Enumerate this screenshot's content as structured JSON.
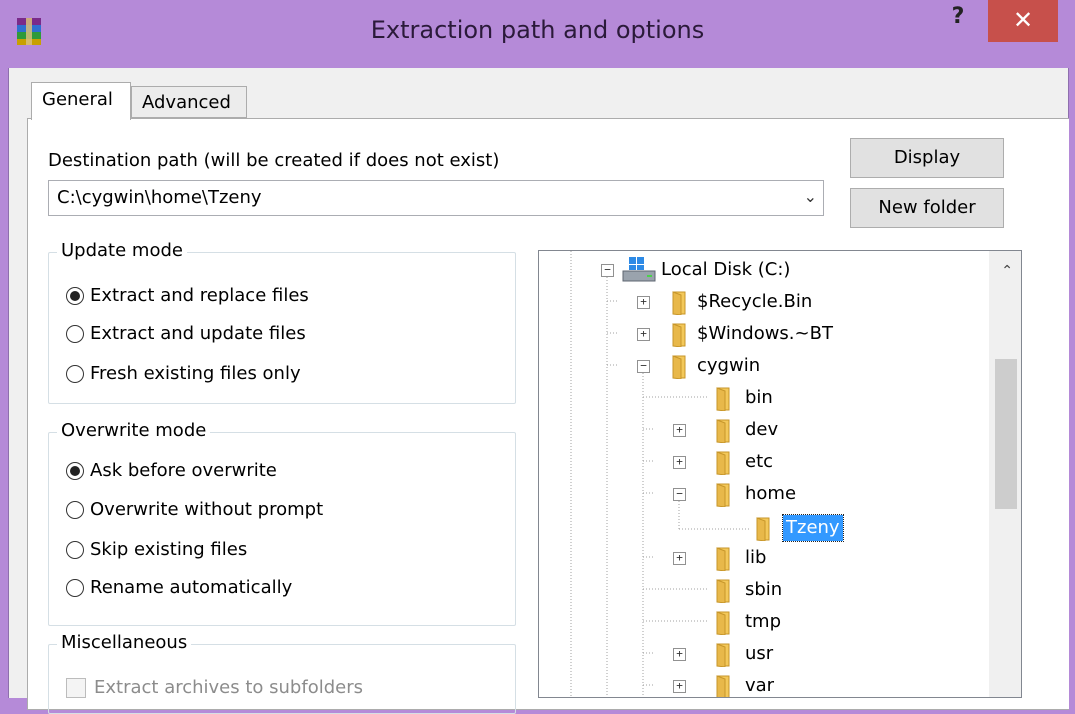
{
  "window": {
    "title": "Extraction path and options",
    "help_label": "?",
    "close_label": "✕"
  },
  "tabs": [
    {
      "label": "General",
      "active": true
    },
    {
      "label": "Advanced",
      "active": false
    }
  ],
  "destination": {
    "label": "Destination path (will be created if does not exist)",
    "value": "C:\\cygwin\\home\\Tzeny"
  },
  "buttons": {
    "display": "Display",
    "new_folder": "New folder"
  },
  "update_mode": {
    "title": "Update mode",
    "options": [
      {
        "label": "Extract and replace files",
        "selected": true
      },
      {
        "label": "Extract and update files",
        "selected": false
      },
      {
        "label": "Fresh existing files only",
        "selected": false
      }
    ]
  },
  "overwrite_mode": {
    "title": "Overwrite mode",
    "options": [
      {
        "label": "Ask before overwrite",
        "selected": true
      },
      {
        "label": "Overwrite without prompt",
        "selected": false
      },
      {
        "label": "Skip existing files",
        "selected": false
      },
      {
        "label": "Rename automatically",
        "selected": false
      }
    ]
  },
  "misc": {
    "title": "Miscellaneous",
    "options": [
      {
        "label": "Extract archives to subfolders",
        "checked": false,
        "enabled": false
      }
    ]
  },
  "tree": {
    "items": [
      {
        "label": "Local Disk (C:)",
        "icon": "drive-icon",
        "expander": "minus"
      },
      {
        "label": "$Recycle.Bin",
        "icon": "folder-icon",
        "expander": "plus"
      },
      {
        "label": "$Windows.~BT",
        "icon": "folder-icon",
        "expander": "plus"
      },
      {
        "label": "cygwin",
        "icon": "folder-icon",
        "expander": "minus"
      },
      {
        "label": "bin",
        "icon": "folder-icon",
        "expander": "none"
      },
      {
        "label": "dev",
        "icon": "folder-icon",
        "expander": "plus"
      },
      {
        "label": "etc",
        "icon": "folder-icon",
        "expander": "plus"
      },
      {
        "label": "home",
        "icon": "folder-icon",
        "expander": "minus"
      },
      {
        "label": "Tzeny",
        "icon": "folder-open-icon",
        "expander": "none",
        "selected": true
      },
      {
        "label": "lib",
        "icon": "folder-icon",
        "expander": "plus"
      },
      {
        "label": "sbin",
        "icon": "folder-icon",
        "expander": "none"
      },
      {
        "label": "tmp",
        "icon": "folder-icon",
        "expander": "none"
      },
      {
        "label": "usr",
        "icon": "folder-icon",
        "expander": "plus"
      },
      {
        "label": "var",
        "icon": "folder-icon",
        "expander": "plus"
      }
    ]
  },
  "colors": {
    "titlebar": "#b58ad8",
    "close": "#c7504b",
    "selection": "#3399ff",
    "folder": "#e8b84a"
  }
}
